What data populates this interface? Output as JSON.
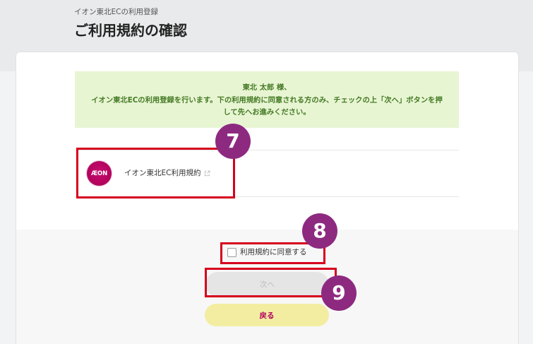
{
  "header": {
    "subtitle": "イオン東北ECの利用登録",
    "title": "ご利用規約の確認"
  },
  "notice": {
    "greeting": "東北 太郎 様、",
    "message_line_1": "イオン東北ECの利用登録を行います。下の利用規約に同意される方のみ、チェックの上「次へ」ボタンを押",
    "message_line_2": "して先へお進みください。"
  },
  "terms": {
    "logo_text": "ÆON",
    "link_label": "イオン東北EC利用規約",
    "link_icon": "external-link-icon"
  },
  "agreement": {
    "checkbox_label": "利用規約に同意する",
    "checked": false
  },
  "buttons": {
    "next_label": "次へ",
    "next_disabled": true,
    "back_label": "戻る"
  },
  "annotations": [
    {
      "label": "7"
    },
    {
      "label": "8"
    },
    {
      "label": "9"
    }
  ],
  "colors": {
    "brand_magenta": "#b2005c",
    "notice_background": "#e8f5d3",
    "notice_text": "#447a24",
    "back_button_background": "#f3eda2",
    "next_button_disabled_background": "#e5e5e5",
    "annotation_red": "#d6001c",
    "annotation_purple": "#8d2a80"
  }
}
